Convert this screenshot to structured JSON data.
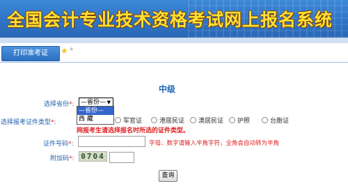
{
  "header": {
    "title": "全国会计专业技术资格考试网上报名系统"
  },
  "tab": {
    "label": "打印准考证"
  },
  "section_title": "中级",
  "form": {
    "province": {
      "label": "选择省份",
      "required_mark": "*",
      "value": "—省份—",
      "options": [
        "—省份—",
        "西 藏"
      ]
    },
    "id_type": {
      "label": "选择报考证件类型",
      "required_mark": "*",
      "visible_options": [
        "军官证",
        "港居民证",
        "澳居民证",
        "护照",
        "台胞证"
      ]
    },
    "warning": "网报考生请选择报名时所选的证件类型。",
    "id_number": {
      "label": "证件号码",
      "required_mark": "*",
      "value": "",
      "hint": "字母、数字请输入半角字符，全角会自动转为半角"
    },
    "captcha": {
      "label": "附加码",
      "required_mark": "*",
      "image_text": "0704",
      "value": ""
    },
    "submit_label": "查询"
  }
}
